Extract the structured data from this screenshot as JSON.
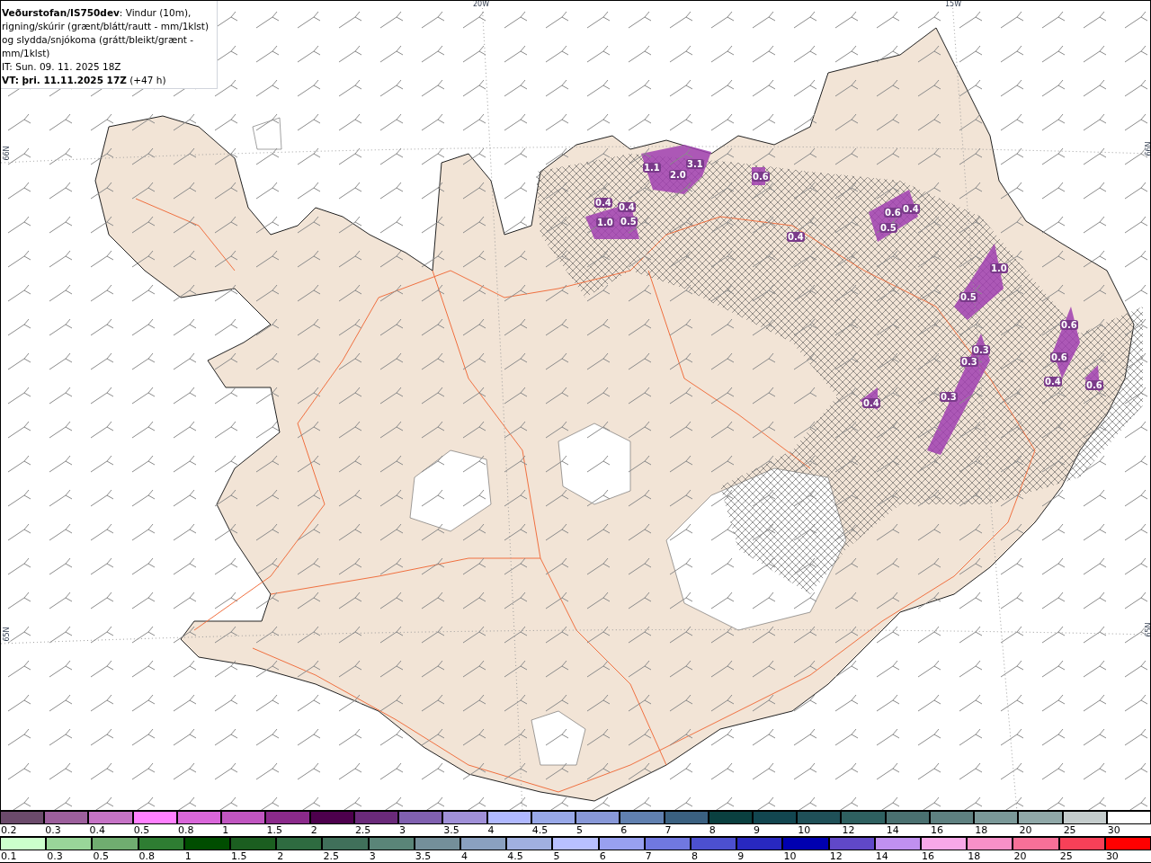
{
  "title_box": {
    "heading": "**Veðurstofan/IS750dev**: Vindur (10m), rigning/skúrir (grænt/blátt/rautt - mm/1klst) og slydda/snjókoma (grátt/bleikt/grænt - mm/1klst)",
    "issue_time": "IT: Sun. 09. 11. 2025 18Z",
    "valid_time": "**VT: þri. 11.11.2025 17Z** (+47 h)"
  },
  "map": {
    "grid_labels": [
      "20W",
      "15W",
      "66N",
      "66N",
      "65N",
      "65N"
    ],
    "precip_labels": [
      "1.1",
      "2.0",
      "3.1",
      "0.4",
      "0.4",
      "1.0",
      "0.5",
      "0.6",
      "0.6",
      "0.4",
      "0.5",
      "0.4",
      "1.0",
      "0.5",
      "0.3",
      "0.3",
      "0.3",
      "0.6",
      "0.4",
      "0.6",
      "0.4",
      "0.6"
    ]
  },
  "legends": [
    {
      "items": [
        {
          "label": "0.2",
          "color": "#6b4a6b"
        },
        {
          "label": "0.3",
          "color": "#9c5f9c"
        },
        {
          "label": "0.4",
          "color": "#c673c6"
        },
        {
          "label": "0.5",
          "color": "#ff80ff"
        },
        {
          "label": "0.8",
          "color": "#d966d9"
        },
        {
          "label": "1",
          "color": "#c055c0"
        },
        {
          "label": "1.5",
          "color": "#8b2a8b"
        },
        {
          "label": "2",
          "color": "#4d004d"
        },
        {
          "label": "2.5",
          "color": "#6a2a7a"
        },
        {
          "label": "3",
          "color": "#8060b0"
        },
        {
          "label": "3.5",
          "color": "#a090d8"
        },
        {
          "label": "4",
          "color": "#b0b8ff"
        },
        {
          "label": "4.5",
          "color": "#98a8e8"
        },
        {
          "label": "5",
          "color": "#8898d8"
        },
        {
          "label": "6",
          "color": "#6080b0"
        },
        {
          "label": "7",
          "color": "#3a6080"
        },
        {
          "label": "8",
          "color": "#0a4040"
        },
        {
          "label": "9",
          "color": "#124650"
        },
        {
          "label": "10",
          "color": "#1f5058"
        },
        {
          "label": "12",
          "color": "#2e6060"
        },
        {
          "label": "14",
          "color": "#4a7070"
        },
        {
          "label": "16",
          "color": "#5e8080"
        },
        {
          "label": "18",
          "color": "#7a9898"
        },
        {
          "label": "20",
          "color": "#90a8a8"
        },
        {
          "label": "25",
          "color": "#c4cccc"
        },
        {
          "label": "30",
          "color": "#ffffff"
        }
      ]
    },
    {
      "items": [
        {
          "label": "0.1",
          "color": "#ccffcc"
        },
        {
          "label": "0.3",
          "color": "#99d699"
        },
        {
          "label": "0.5",
          "color": "#70ad70"
        },
        {
          "label": "0.8",
          "color": "#2e7d32"
        },
        {
          "label": "1",
          "color": "#004d00"
        },
        {
          "label": "1.5",
          "color": "#1b5e20"
        },
        {
          "label": "2",
          "color": "#2e6b40"
        },
        {
          "label": "2.5",
          "color": "#40705a"
        },
        {
          "label": "3",
          "color": "#5a8578"
        },
        {
          "label": "3.5",
          "color": "#748f9a"
        },
        {
          "label": "4",
          "color": "#8aa0c0"
        },
        {
          "label": "4.5",
          "color": "#a0b0e0"
        },
        {
          "label": "5",
          "color": "#b8c0ff"
        },
        {
          "label": "6",
          "color": "#98a0f0"
        },
        {
          "label": "7",
          "color": "#7078e0"
        },
        {
          "label": "8",
          "color": "#4c50d0"
        },
        {
          "label": "9",
          "color": "#2828c0"
        },
        {
          "label": "10",
          "color": "#0000b0"
        },
        {
          "label": "12",
          "color": "#6048c8"
        },
        {
          "label": "14",
          "color": "#c090f0"
        },
        {
          "label": "16",
          "color": "#f8a8e8"
        },
        {
          "label": "18",
          "color": "#f890c8"
        },
        {
          "label": "20",
          "color": "#f87098"
        },
        {
          "label": "25",
          "color": "#f84058"
        },
        {
          "label": "30",
          "color": "#ff0000"
        }
      ]
    }
  ]
}
